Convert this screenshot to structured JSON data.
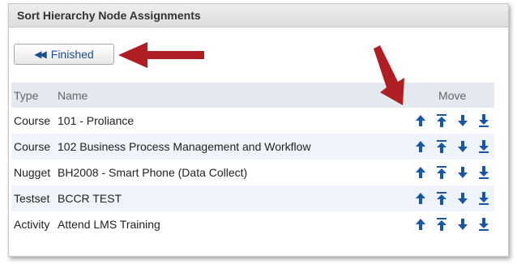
{
  "panel": {
    "title": "Sort Hierarchy Node Assignments"
  },
  "toolbar": {
    "finished_label": "Finished",
    "finished_icon": "double-chevron-left-icon"
  },
  "table": {
    "headers": {
      "type": "Type",
      "name": "Name",
      "move": "Move"
    },
    "rows": [
      {
        "type": "Course",
        "name": "101 - Proliance"
      },
      {
        "type": "Course",
        "name": "102 Business Process Management and Workflow"
      },
      {
        "type": "Nugget",
        "name": "BH2008 - Smart Phone (Data Collect)"
      },
      {
        "type": "Testset",
        "name": "BCCR TEST"
      },
      {
        "type": "Activity",
        "name": "Attend LMS Training"
      }
    ]
  },
  "colors": {
    "accent": "#1a56a6",
    "annotation_arrow": "#b01e23",
    "row_alt": "#eef4f9",
    "header_bg": "#e3e9ee"
  }
}
